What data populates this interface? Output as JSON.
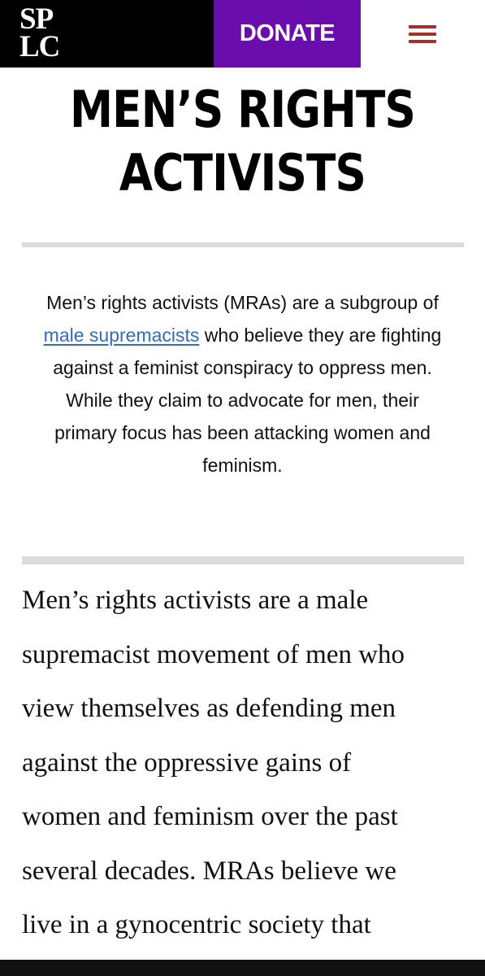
{
  "header": {
    "logo_line1": "SP",
    "logo_line2": "LC",
    "donate_label": "DONATE",
    "menu_icon": "hamburger-menu-icon",
    "colors": {
      "logo_bg": "#000000",
      "donate_bg": "#6a0dad",
      "menu_icon": "#a0322c"
    }
  },
  "article": {
    "title": "MEN’S RIGHTS ACTIVISTS",
    "summary_before_link": "Men’s rights activists (MRAs) are a subgroup of ",
    "summary_link": "male supremacists",
    "summary_after_link": " who believe they are fighting against a feminist conspiracy to oppress men. While they claim to advocate for men, their primary focus has been attacking women and feminism.",
    "body_lines": [
      "Men’s rights activists are a male",
      "supremacist movement of men who",
      "view themselves as defending men",
      "against the oppressive gains of",
      "women and feminism over the past",
      "several decades. MRAs believe we",
      "live in a gynocentric society that"
    ],
    "colors": {
      "link": "#3a6ab0",
      "divider": "#dcdcdc"
    }
  }
}
